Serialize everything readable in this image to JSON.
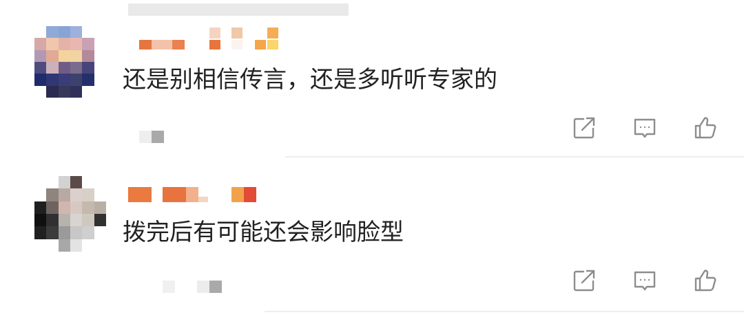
{
  "comments": [
    {
      "text": "还是别相信传言，还是多听听专家的",
      "icons": {
        "share": "share-icon",
        "reply": "comment-icon",
        "like": "thumbs-up-icon"
      }
    },
    {
      "text": "拨完后有可能还会影响脸型",
      "icons": {
        "share": "share-icon",
        "reply": "comment-icon",
        "like": "thumbs-up-icon"
      }
    }
  ],
  "colors": {
    "text": "#222222",
    "icon": "#8c8c8c",
    "divider": "#eeeeee"
  }
}
